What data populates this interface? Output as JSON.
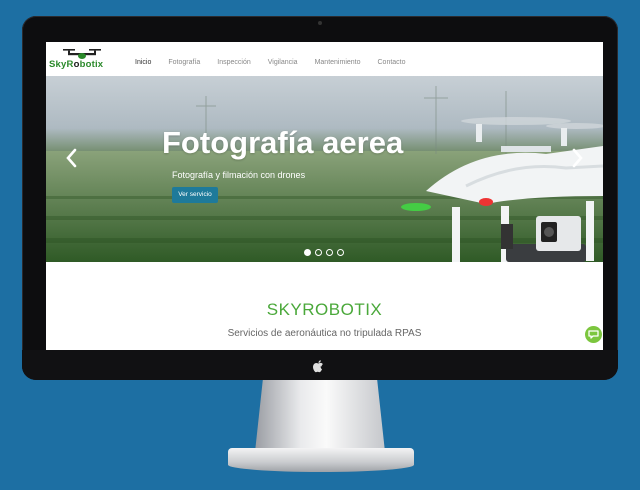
{
  "site": {
    "logo_text_1": "SkyR",
    "logo_text_2": "o",
    "logo_text_3": "botix"
  },
  "nav": {
    "items": [
      "Inicio",
      "Fotografía",
      "Inspección",
      "Vigilancia",
      "Mantenimiento",
      "Contacto"
    ],
    "active": "Inicio"
  },
  "hero": {
    "title": "Fotografía aerea",
    "subtitle": "Fotografía y filmación con drones",
    "button_label": "Ver servicio",
    "slides_count": 4,
    "active_slide": 1
  },
  "content": {
    "title": "SKYROBOTIX",
    "subtitle": "Servicios de aeronáutica no tripulada RPAS"
  },
  "colors": {
    "background": "#1d6fa3",
    "brand_green": "#4aa83a",
    "button_blue": "#1e7a9a",
    "chat_green": "#7cc63e"
  }
}
